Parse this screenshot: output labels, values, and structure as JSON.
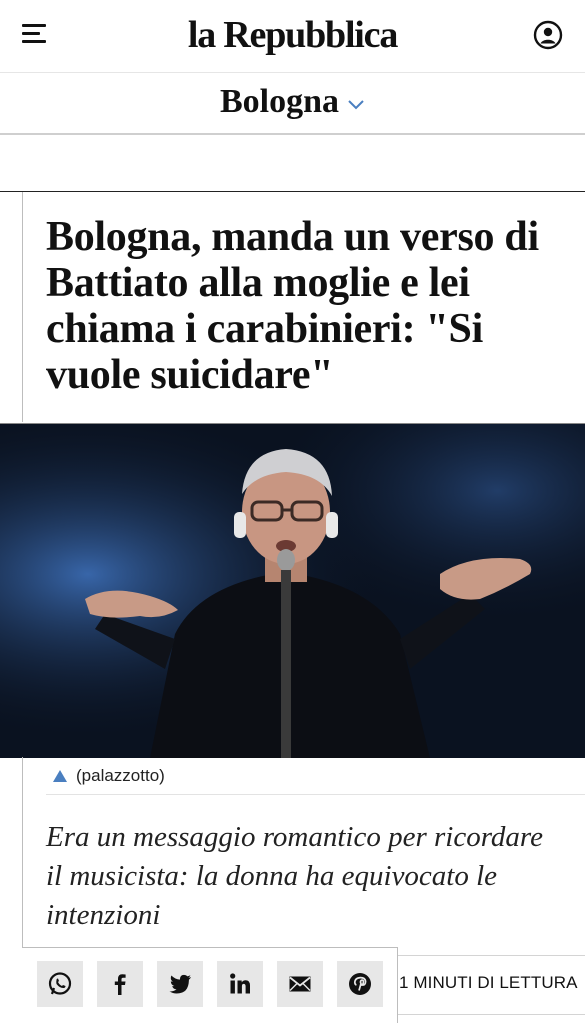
{
  "header": {
    "logo_text": "la Repubblica",
    "menu_icon": "hamburger-menu-icon",
    "user_icon": "user-account-icon"
  },
  "section": {
    "title": "Bologna",
    "dropdown_icon": "chevron-down-icon",
    "accent_color": "#4a7fc0"
  },
  "article": {
    "headline": "Bologna, manda un verso di Battiato alla moglie e lei chiama i carabinieri: \"Si vuole suicidare\"",
    "photo_caption": "(palazzotto)",
    "summary": "Era un messaggio romantico per ricordare il musicista: la donna ha equivocato le intenzioni",
    "reading_time": "1 MINUTI DI LETTURA"
  },
  "share": {
    "buttons": [
      {
        "name": "whatsapp",
        "icon": "whatsapp-icon"
      },
      {
        "name": "facebook",
        "icon": "facebook-icon"
      },
      {
        "name": "twitter",
        "icon": "twitter-icon"
      },
      {
        "name": "linkedin",
        "icon": "linkedin-icon"
      },
      {
        "name": "email",
        "icon": "mail-icon"
      },
      {
        "name": "pinterest",
        "icon": "pinterest-icon"
      }
    ]
  }
}
